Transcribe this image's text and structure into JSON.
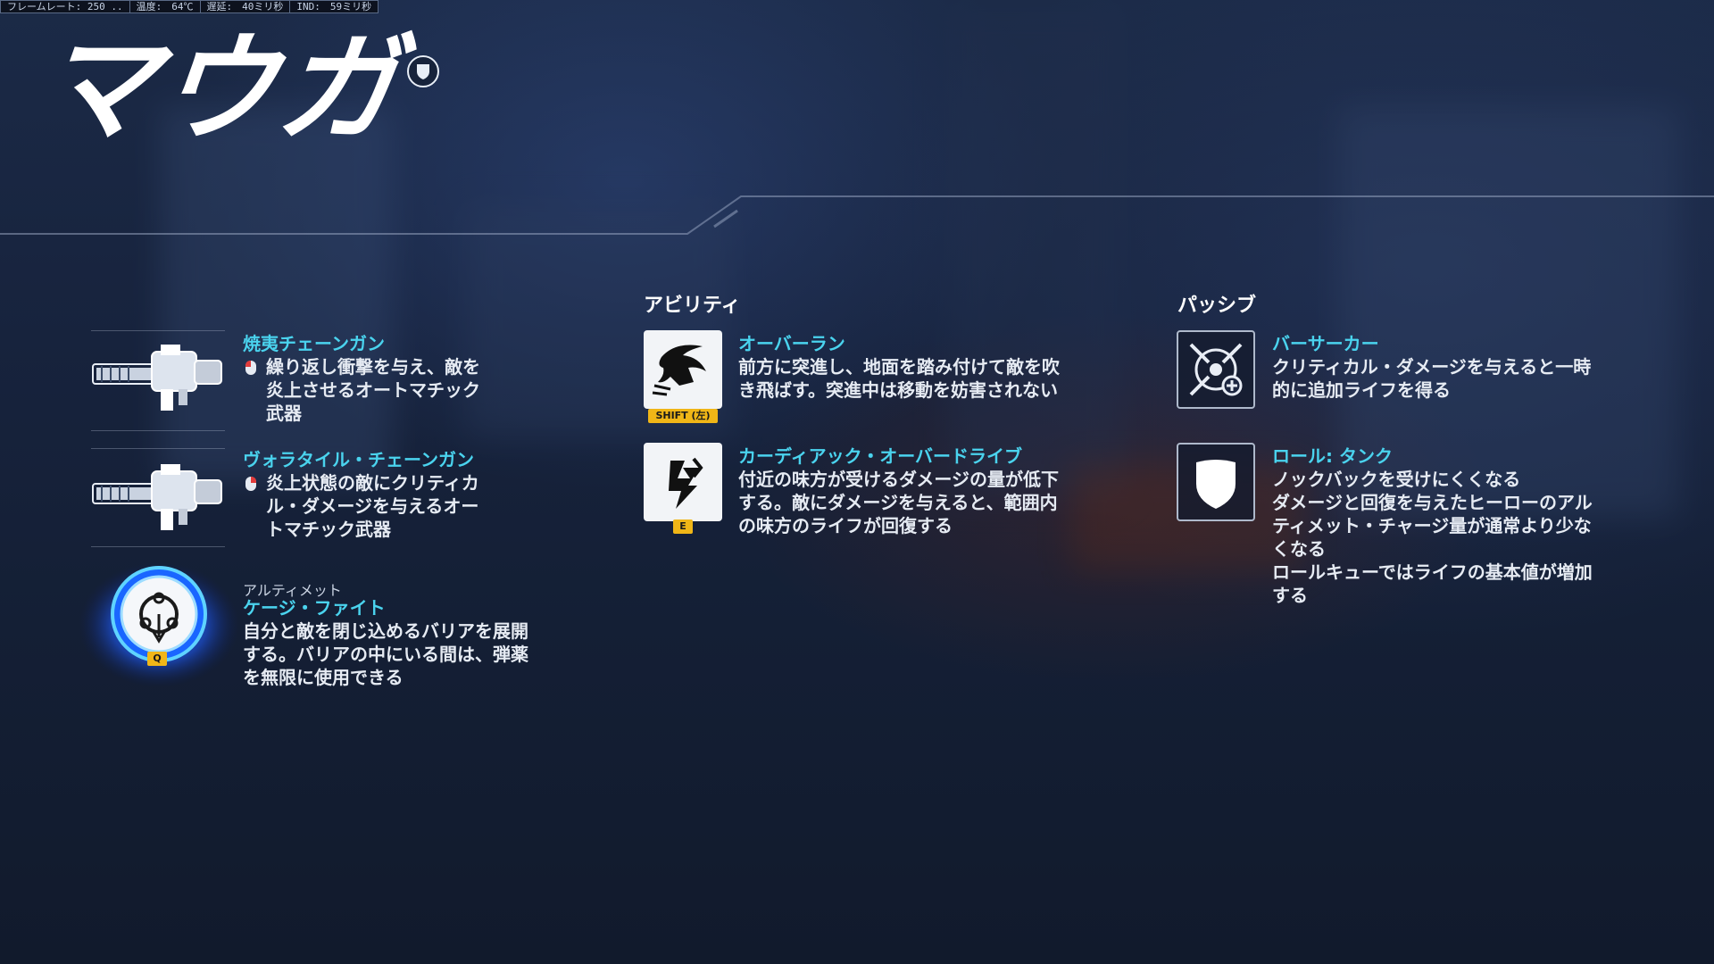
{
  "perf_bar": {
    "framerate": "フレームレート: 250 ..",
    "temperature": "温度:　64℃",
    "latency": "遅延:　40ミリ秒",
    "ind": "IND:　59ミリ秒"
  },
  "hero": {
    "name": "マウガ",
    "role_icon": "tank-role-icon"
  },
  "weapons": [
    {
      "name": "焼夷チェーンガン",
      "input_icon": "mouse-left-icon",
      "description": "繰り返し衝撃を与え、敵を炎上させるオートマチック武器",
      "lines": [
        "繰り返し衝撃を与え、敵を",
        "炎上させるオートマチック",
        "武器"
      ],
      "icon": "chaingun-icon"
    },
    {
      "name": "ヴォラタイル・チェーンガン",
      "input_icon": "mouse-right-icon",
      "description": "炎上状態の敵にクリティカル・ダメージを与えるオートマチック武器",
      "lines": [
        "炎上状態の敵にクリティカ",
        "ル・ダメージを与えるオー",
        "トマチック武器"
      ],
      "icon": "chaingun-icon"
    }
  ],
  "ultimate": {
    "label": "アルティメット",
    "name": "ケージ・ファイト",
    "key": "Q",
    "description": "自分と敵を閉じ込めるバリアを展開する。バリアの中にいる間は、弾薬を無限に使用できる",
    "lines": [
      "自分と敵を閉じ込めるバリアを展開",
      "する。バリアの中にいる間は、弾薬",
      "を無限に使用できる"
    ],
    "icon": "cage-chain-icon"
  },
  "abilities": {
    "heading": "アビリティ",
    "items": [
      {
        "name": "オーバーラン",
        "key": "SHIFT (左)",
        "lines": [
          "前方に突進し、地面を踏み付けて敵を吹",
          "き飛ばす。突進中は移動を妨害されない"
        ],
        "icon": "overrun-charge-icon"
      },
      {
        "name": "カーディアック・オーバードライブ",
        "key": "E",
        "lines": [
          "付近の味方が受けるダメージの量が低下",
          "する。敵にダメージを与えると、範囲内",
          "の味方のライフが回復する"
        ],
        "icon": "cardiac-overdrive-icon"
      }
    ]
  },
  "passives": {
    "heading": "パッシブ",
    "items": [
      {
        "name": "バーサーカー",
        "lines": [
          "クリティカル・ダメージを与えると一時",
          "的に追加ライフを得る"
        ],
        "icon": "berserker-icon"
      },
      {
        "name": "ロール: タンク",
        "lines": [
          "ノックバックを受けにくくなる",
          "ダメージと回復を与えたヒーローのアル",
          "ティメット・チャージ量が通常より少な",
          "くなる",
          "ロールキューではライフの基本値が増加",
          "する"
        ],
        "icon": "tank-shield-icon"
      }
    ]
  },
  "colors": {
    "accent_cyan": "#4ad3ee",
    "key_yellow": "#f0b617",
    "ult_blue": "#1e6fff"
  }
}
